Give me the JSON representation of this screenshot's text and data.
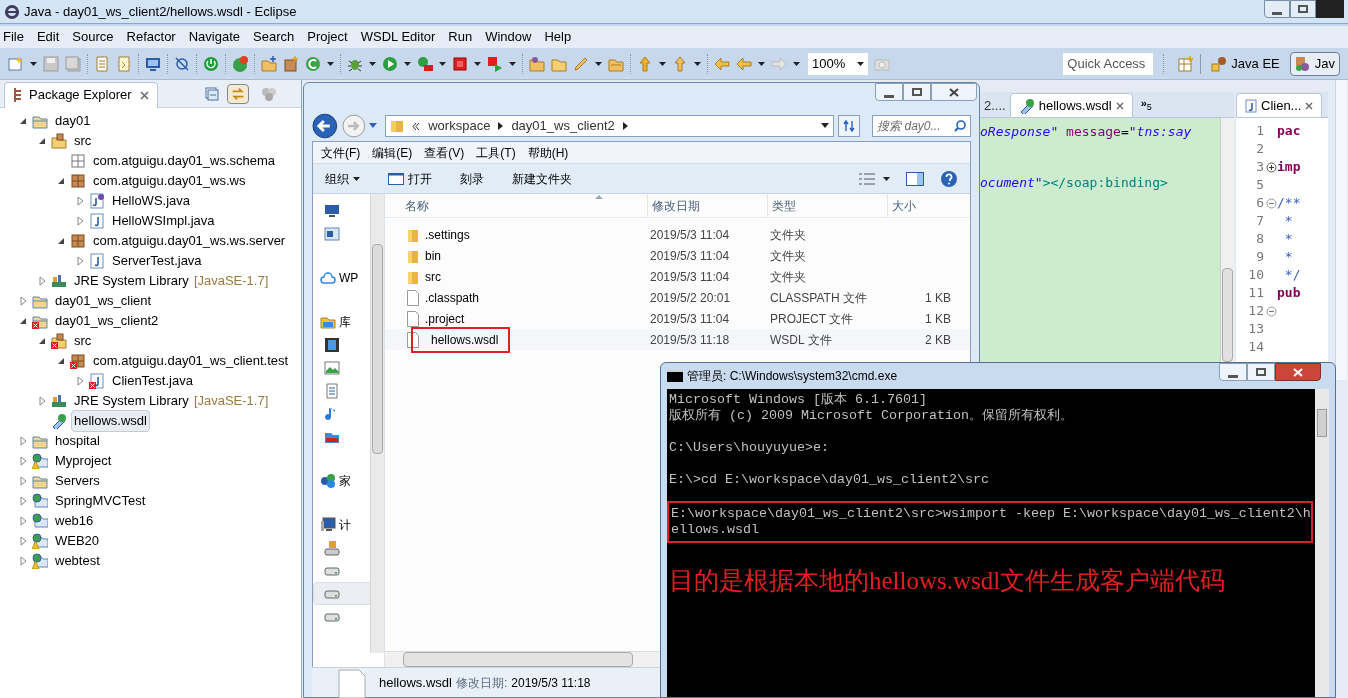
{
  "window": {
    "title": "Java - day01_ws_client2/hellows.wsdl - Eclipse"
  },
  "menu": [
    "File",
    "Edit",
    "Source",
    "Refactor",
    "Navigate",
    "Search",
    "Project",
    "WSDL Editor",
    "Run",
    "Window",
    "Help"
  ],
  "toolbar": {
    "zoom": "100%",
    "quick_access": "Quick Access",
    "perspectives": [
      {
        "label": "Java EE",
        "selected": false
      },
      {
        "label": "Jav",
        "selected": true
      }
    ]
  },
  "package_explorer": {
    "title": "Package Explorer",
    "tree": [
      {
        "label": "day01",
        "kind": "project",
        "expanded": true,
        "children": [
          {
            "label": "src",
            "kind": "srcfolder",
            "expanded": true,
            "children": [
              {
                "label": "com.atguigu.day01_ws.schema",
                "kind": "emptypackage"
              },
              {
                "label": "com.atguigu.day01_ws.ws",
                "kind": "package",
                "expanded": true,
                "children": [
                  {
                    "label": "HelloWS.java",
                    "kind": "interface",
                    "expanded": false
                  },
                  {
                    "label": "HelloWSImpl.java",
                    "kind": "java",
                    "expanded": false
                  }
                ]
              },
              {
                "label": "com.atguigu.day01_ws.ws.server",
                "kind": "package",
                "expanded": true,
                "children": [
                  {
                    "label": "ServerTest.java",
                    "kind": "java",
                    "expanded": false
                  }
                ]
              }
            ]
          },
          {
            "label": "JRE System Library",
            "suffix": "[JavaSE-1.7]",
            "kind": "library",
            "expanded": false
          }
        ]
      },
      {
        "label": "day01_ws_client",
        "kind": "project",
        "expanded": false
      },
      {
        "label": "day01_ws_client2",
        "kind": "project",
        "expanded": true,
        "error": true,
        "children": [
          {
            "label": "src",
            "kind": "srcfolder",
            "expanded": true,
            "error": true,
            "children": [
              {
                "label": "com.atguigu.day01_ws_client.test",
                "kind": "package",
                "expanded": true,
                "error": true,
                "children": [
                  {
                    "label": "ClienTest.java",
                    "kind": "java",
                    "expanded": false,
                    "error": true
                  }
                ]
              }
            ]
          },
          {
            "label": "JRE System Library",
            "suffix": "[JavaSE-1.7]",
            "kind": "library",
            "expanded": false
          },
          {
            "label": "hellows.wsdl",
            "kind": "wsdl",
            "selected": true
          }
        ]
      },
      {
        "label": "hospital",
        "kind": "project",
        "expanded": false
      },
      {
        "label": "Myproject",
        "kind": "webproject",
        "expanded": false,
        "warning": true
      },
      {
        "label": "Servers",
        "kind": "project",
        "expanded": false
      },
      {
        "label": "SpringMVCTest",
        "kind": "webproject",
        "expanded": false
      },
      {
        "label": "web16",
        "kind": "webproject",
        "expanded": false
      },
      {
        "label": "WEB20",
        "kind": "webproject",
        "expanded": false,
        "warning": true
      },
      {
        "label": "webtest",
        "kind": "webproject",
        "expanded": false,
        "warning": true
      }
    ]
  },
  "wsdl_editor": {
    "tabs": [
      {
        "label": "2....",
        "selected": false
      },
      {
        "label": "hellows.wsdl",
        "selected": true
      }
    ],
    "overflow": "»",
    "overflow_count": "5",
    "lines": [
      {
        "kind": "code",
        "segments": [
          {
            "text": "oResponse\"",
            "kind": "value"
          },
          {
            "text": " message",
            "kind": "attr"
          },
          {
            "text": "=",
            "kind": "plain"
          },
          {
            "text": "\"tns:say",
            "kind": "value"
          }
        ]
      },
      {
        "kind": "blank"
      },
      {
        "kind": "blank"
      },
      {
        "kind": "code",
        "segments": [
          {
            "text": "ocument\"",
            "kind": "value"
          },
          {
            "text": "></soap:binding>",
            "kind": "tag"
          }
        ]
      }
    ]
  },
  "java_editor": {
    "tab": "Clien...",
    "lines": [
      {
        "number": "1",
        "code": "pac"
      },
      {
        "number": "2"
      },
      {
        "number": "3",
        "code": "imp",
        "folded": true
      },
      {
        "number": "5"
      },
      {
        "number": "6",
        "code": "/**",
        "folded": false,
        "comment": true
      },
      {
        "number": "7",
        "code": " *",
        "comment": true
      },
      {
        "number": "8",
        "code": " *",
        "comment": true
      },
      {
        "number": "9",
        "code": " *",
        "comment": true
      },
      {
        "number": "10",
        "code": " */",
        "comment": true
      },
      {
        "number": "11",
        "code": "pub"
      },
      {
        "number": "12",
        "folded": false
      },
      {
        "number": "13"
      },
      {
        "number": "14"
      }
    ]
  },
  "explorer": {
    "path": [
      "workspace",
      "day01_ws_client2"
    ],
    "search_placeholder": "搜索 day0...",
    "menu": [
      "文件(F)",
      "编辑(E)",
      "查看(V)",
      "工具(T)",
      "帮助(H)"
    ],
    "toolbar": [
      {
        "label": "组织",
        "kind": "dropdown"
      },
      {
        "label": "打开",
        "kind": "open"
      },
      {
        "label": "刻录",
        "kind": "plain"
      },
      {
        "label": "新建文件夹",
        "kind": "plain"
      }
    ],
    "nav": [
      {
        "items": [
          {
            "kind": "desktop",
            "selected": false
          },
          {
            "kind": "recent",
            "selected": false
          }
        ]
      },
      {
        "items": [
          {
            "label": "WP",
            "kind": "cloud",
            "selected": false
          }
        ]
      },
      {
        "items": [
          {
            "label": "库",
            "kind": "library",
            "selected": false
          },
          {
            "kind": "video",
            "selected": false
          },
          {
            "kind": "picture",
            "selected": false
          },
          {
            "kind": "document",
            "selected": false
          },
          {
            "kind": "music",
            "selected": false
          },
          {
            "kind": "folder",
            "selected": false
          }
        ]
      },
      {
        "items": [
          {
            "label": "家",
            "kind": "homegroup",
            "selected": false
          }
        ]
      },
      {
        "items": [
          {
            "label": "计",
            "kind": "computer",
            "selected": false
          },
          {
            "kind": "sysdrive",
            "selected": false
          },
          {
            "kind": "drive",
            "selected": false
          },
          {
            "kind": "drive",
            "selected": true
          },
          {
            "kind": "drive",
            "selected": false
          }
        ]
      }
    ],
    "columns": [
      "名称",
      "修改日期",
      "类型",
      "大小"
    ],
    "files": [
      {
        "name": ".settings",
        "date": "2019/5/3 11:04",
        "type": "文件夹",
        "kind": "folder",
        "marked": false
      },
      {
        "name": "bin",
        "date": "2019/5/3 11:04",
        "type": "文件夹",
        "kind": "folder",
        "marked": false
      },
      {
        "name": "src",
        "date": "2019/5/3 11:04",
        "type": "文件夹",
        "kind": "folder",
        "marked": false
      },
      {
        "name": ".classpath",
        "date": "2019/5/2 20:01",
        "type": "CLASSPATH 文件",
        "size": "1 KB",
        "kind": "file",
        "marked": false
      },
      {
        "name": ".project",
        "date": "2019/5/3 11:04",
        "type": "PROJECT 文件",
        "size": "1 KB",
        "kind": "file",
        "marked": false
      },
      {
        "name": "hellows.wsdl",
        "date": "2019/5/3 11:18",
        "type": "WSDL 文件",
        "size": "2 KB",
        "kind": "file",
        "marked": true
      }
    ],
    "details": {
      "name": "hellows.wsdl",
      "label": "修改日期:",
      "value": "2019/5/3 11:18"
    }
  },
  "cmd": {
    "title": "管理员: C:\\Windows\\system32\\cmd.exe",
    "blocks": [
      {
        "boxed": false,
        "lines": [
          "Microsoft Windows [版本 6.1.7601]",
          "版权所有 (c) 2009 Microsoft Corporation。保留所有权利。"
        ]
      },
      {
        "boxed": false,
        "lines": [
          "C:\\Users\\houyuyue>e:"
        ]
      },
      {
        "boxed": false,
        "lines": [
          "E:\\>cd E:\\workspace\\day01_ws_client2\\src"
        ]
      },
      {
        "boxed": true,
        "lines": [
          "E:\\workspace\\day01_ws_client2\\src>wsimport -keep E:\\workspace\\day01_ws_client2\\h",
          "ellows.wsdl"
        ]
      }
    ],
    "annotation": "目的是根据本地的hellows.wsdl文件生成客户端代码"
  }
}
